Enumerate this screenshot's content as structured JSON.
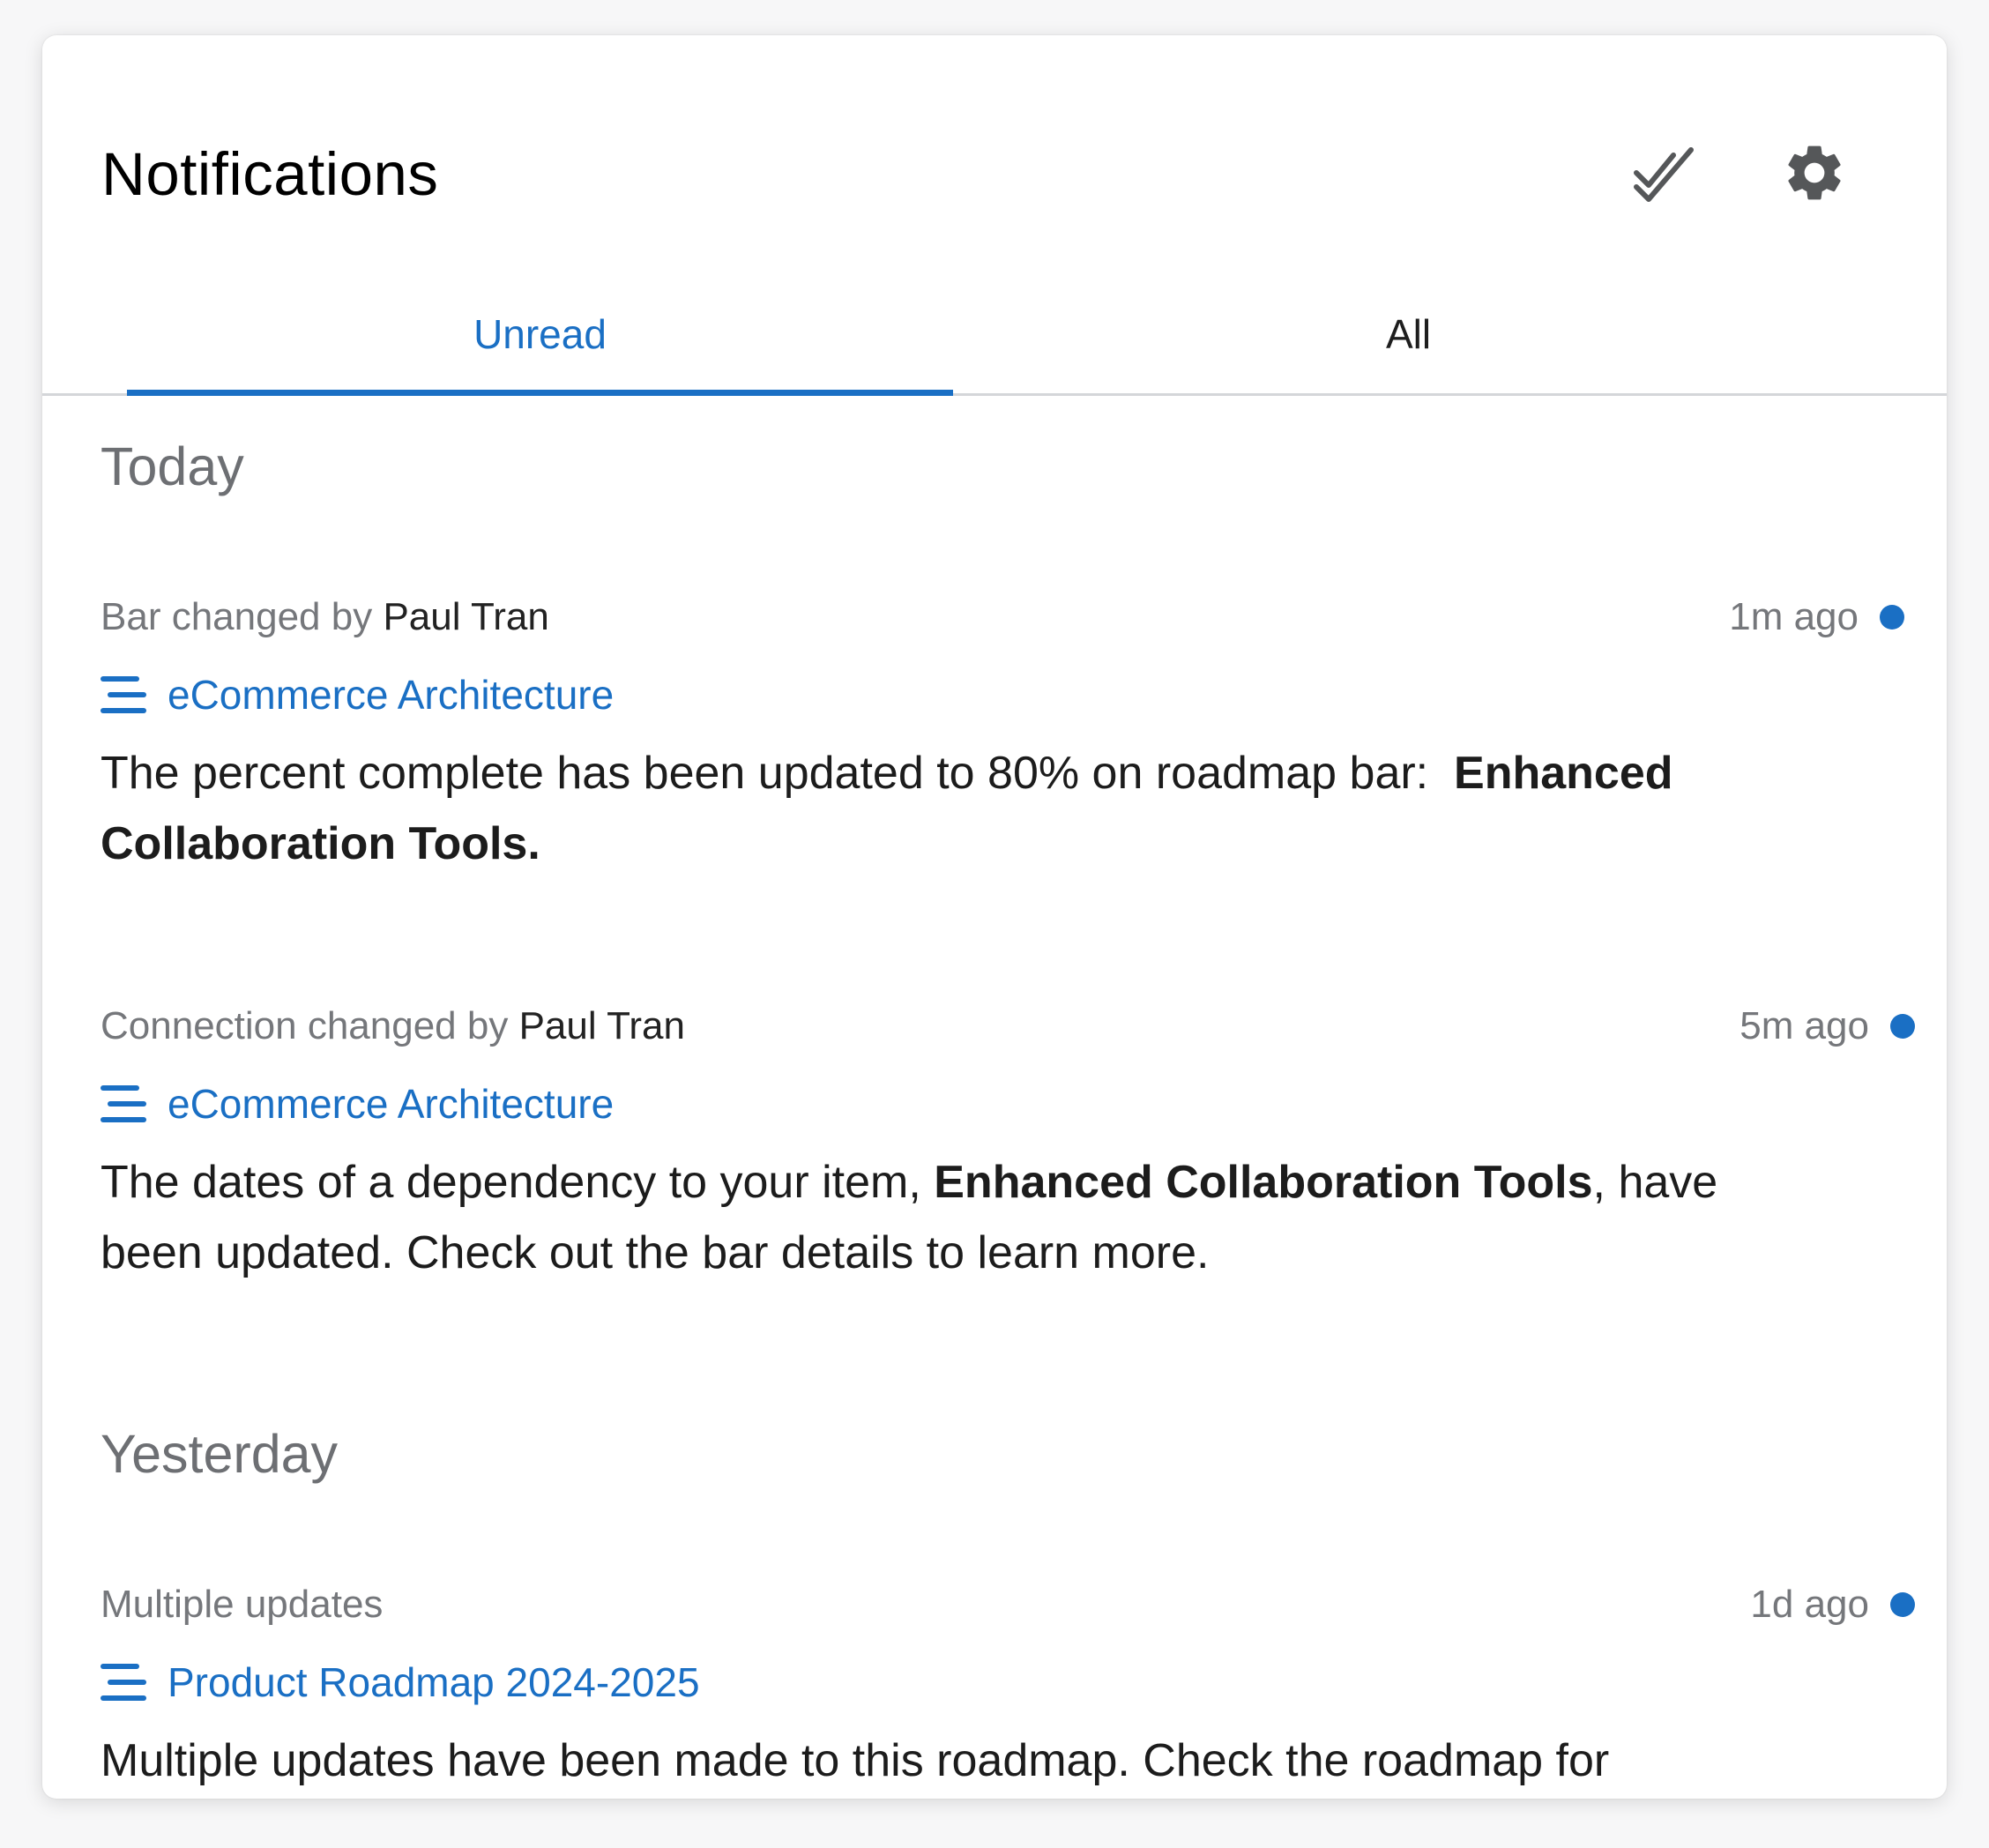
{
  "header": {
    "title": "Notifications",
    "mark_all_read_icon": "double-check-icon",
    "settings_icon": "gear-icon"
  },
  "tabs": [
    {
      "label": "Unread",
      "active": true
    },
    {
      "label": "All",
      "active": false
    }
  ],
  "colors": {
    "accent": "#1a6fc4",
    "muted_text": "#75777b",
    "heading_text": "#6d6f73",
    "body_text": "#1c1c1c"
  },
  "sections": [
    {
      "heading": "Today",
      "items": [
        {
          "action": "Bar changed by",
          "actor": "Paul Tran",
          "time": "1m ago",
          "unread": true,
          "roadmap": "eCommerce Architecture",
          "roadmap_icon": "roadmap-lines-icon",
          "body_before": "The percent complete has been updated to 80% on roadmap bar:",
          "body_bold": "Enhanced Collaboration Tools.",
          "body_after": ""
        },
        {
          "action": "Connection changed by",
          "actor": "Paul Tran",
          "time": "5m ago",
          "unread": true,
          "roadmap": "eCommerce Architecture",
          "roadmap_icon": "roadmap-lines-icon",
          "body_before": "The dates of a dependency to your item,",
          "body_bold": "Enhanced Collaboration Tools",
          "body_after": ", have been updated. Check out the bar details to learn more."
        }
      ]
    },
    {
      "heading": "Yesterday",
      "items": [
        {
          "action": "Multiple updates",
          "actor": "",
          "time": "1d ago",
          "unread": true,
          "roadmap": "Product Roadmap 2024-2025",
          "roadmap_icon": "roadmap-lines-icon",
          "body_before": "Multiple updates have been made to this roadmap. Check the roadmap for",
          "body_bold": "",
          "body_after": ""
        }
      ]
    }
  ]
}
